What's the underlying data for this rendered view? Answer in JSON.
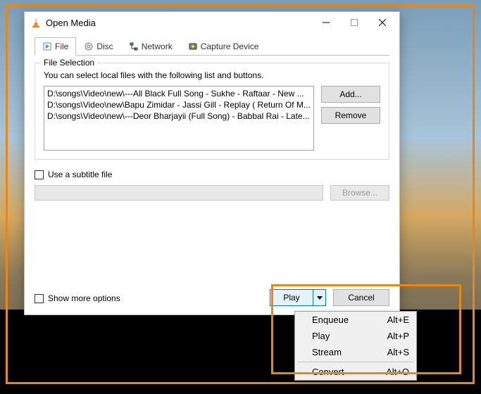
{
  "window": {
    "title": "Open Media"
  },
  "tabs": {
    "file": "File",
    "disc": "Disc",
    "network": "Network",
    "capture": "Capture Device"
  },
  "fileSelection": {
    "legend": "File Selection",
    "help": "You can select local files with the following list and buttons.",
    "files": [
      "D:\\songs\\Video\\new\\---All Black Full Song - Sukhe - Raftaar -  New ...",
      "D:\\songs\\Video\\new\\Bapu Zimidar - Jassi Gill - Replay ( Return Of M...",
      "D:\\songs\\Video\\new\\---Deor Bharjayii (Full Song) - Babbal Rai - Late..."
    ],
    "addLabel": "Add...",
    "removeLabel": "Remove"
  },
  "subtitle": {
    "checkboxLabel": "Use a subtitle file",
    "browseLabel": "Browse..."
  },
  "showMoreLabel": "Show more options",
  "buttons": {
    "play": "Play",
    "cancel": "Cancel"
  },
  "dropdown": {
    "items": [
      {
        "label": "Enqueue",
        "shortcut": "Alt+E"
      },
      {
        "label": "Play",
        "shortcut": "Alt+P"
      },
      {
        "label": "Stream",
        "shortcut": "Alt+S"
      },
      {
        "label": "Convert",
        "shortcut": "Alt+O"
      }
    ]
  }
}
